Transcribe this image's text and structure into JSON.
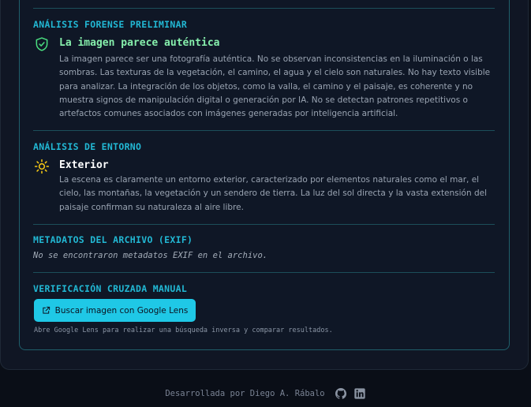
{
  "forensic": {
    "title": "ANÁLISIS FORENSE PRELIMINAR",
    "verdict": "La imagen parece auténtica",
    "verdict_color": "#86efac",
    "icon": "shield-check-icon",
    "description": "La imagen parece ser una fotografía auténtica. No se observan inconsistencias en la iluminación o las sombras. Las texturas de la vegetación, el camino, el agua y el cielo son naturales. No hay texto visible para analizar. La integración de los objetos, como la valla, el camino y el paisaje, es coherente y no muestra signos de manipulación digital o generación por IA. No se detectan patrones repetitivos o artefactos comunes asociados con imágenes generadas por inteligencia artificial."
  },
  "environment": {
    "title": "ANÁLISIS DE ENTORNO",
    "heading": "Exterior",
    "icon": "sun-icon",
    "description": "La escena es claramente un entorno exterior, caracterizado por elementos naturales como el mar, el cielo, las montañas, la vegetación y un sendero de tierra. La luz del sol directa y la vasta extensión del paisaje confirman su naturaleza al aire libre."
  },
  "exif": {
    "title": "METADATOS DEL ARCHIVO (EXIF)",
    "note": "No se encontraron metadatos EXIF en el archivo."
  },
  "manual_check": {
    "title": "VERIFICACIÓN CRUZADA MANUAL",
    "button_label": "Buscar imagen con Google Lens",
    "button_icon": "external-link-icon",
    "hint": "Abre Google Lens para realizar una búsqueda inversa y comparar resultados."
  },
  "footer": {
    "credit": "Desarrollada por Diego A. Rábalo",
    "icons": [
      "github-icon",
      "linkedin-icon"
    ]
  },
  "colors": {
    "accent": "#22b8d4",
    "button": "#1fc8e6",
    "success": "#4ade80",
    "sun": "#facc15"
  }
}
